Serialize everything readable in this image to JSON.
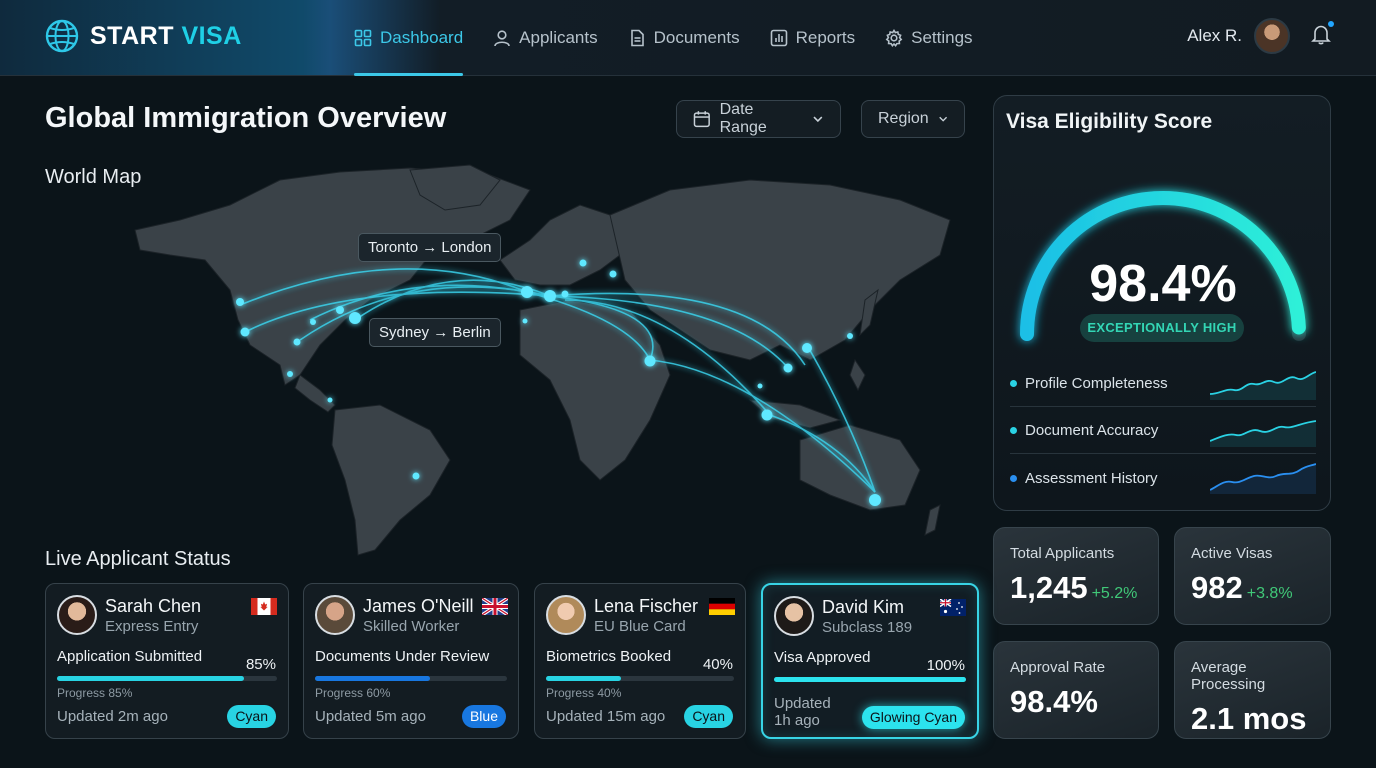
{
  "brand": {
    "part1": "START",
    "part2": "VISA",
    "icon": "globe-icon"
  },
  "nav": [
    {
      "label": "Dashboard",
      "icon": "grid-icon",
      "active": true
    },
    {
      "label": "Applicants",
      "icon": "user-icon"
    },
    {
      "label": "Documents",
      "icon": "document-icon"
    },
    {
      "label": "Reports",
      "icon": "bar-chart-icon"
    },
    {
      "label": "Settings",
      "icon": "gear-icon"
    }
  ],
  "user": {
    "name": "Alex R."
  },
  "page": {
    "title": "Global Immigration Overview"
  },
  "filters": {
    "date_range": "Date Range",
    "region": "Region"
  },
  "map": {
    "label": "World Map",
    "route_tags": [
      "Toronto → London",
      "Sydney → Berlin"
    ]
  },
  "eligibility": {
    "title": "Visa Eligibility Score",
    "score": "98.4%",
    "score_value": 0.984,
    "badge": "EXCEPTIONALLY HIGH",
    "metrics": [
      {
        "label": "Profile Completeness",
        "color": "#2ad2e4"
      },
      {
        "label": "Document Accuracy",
        "color": "#2ad2e4"
      },
      {
        "label": "Assessment History",
        "color": "#2a8ff0"
      }
    ]
  },
  "stats": [
    {
      "label": "Total Applicants",
      "value": "1,245",
      "delta": "+5.2%"
    },
    {
      "label": "Active Visas",
      "value": "982",
      "delta": "+3.8%"
    },
    {
      "label": "Approval Rate",
      "value": "98.4%"
    },
    {
      "label": "Average Processing",
      "value": "2.1 mos"
    }
  ],
  "applicants_section": {
    "label": "Live Applicant Status"
  },
  "applicants": [
    {
      "name": "Sarah Chen",
      "program": "Express Entry",
      "flag": "canada-flag",
      "status": "Application Submitted",
      "percent": "85%",
      "progress": 0.85,
      "progress_text": "Progress 85%",
      "updated": "Updated 2m ago",
      "tag": "Cyan",
      "bar_color": "#28d3e3"
    },
    {
      "name": "James O'Neill",
      "program": "Skilled Worker",
      "flag": "uk-flag",
      "status": "Documents Under Review",
      "progress": 0.6,
      "progress_text": "Progress 60%",
      "updated": "Updated 5m ago",
      "tag": "Blue",
      "bar_color": "#1877e0"
    },
    {
      "name": "Lena Fischer",
      "program": "EU Blue Card",
      "flag": "germany-flag",
      "status": "Biometrics Booked",
      "percent": "40%",
      "progress": 0.4,
      "progress_text": "Progress 40%",
      "updated": "Updated 15m ago",
      "tag": "Cyan",
      "bar_color": "#28d3e3"
    },
    {
      "name": "David Kim",
      "program": "Subclass 189",
      "flag": "australia-flag",
      "status": "Visa Approved",
      "percent": "100%",
      "progress": 1.0,
      "updated_line1": "Updated",
      "updated_line2": "1h ago",
      "tag": "Glowing Cyan",
      "bar_color": "#2ce3ee"
    }
  ],
  "colors": {
    "accent": "#3cc8e8",
    "positive": "#40c878",
    "background": "#0b1419"
  }
}
